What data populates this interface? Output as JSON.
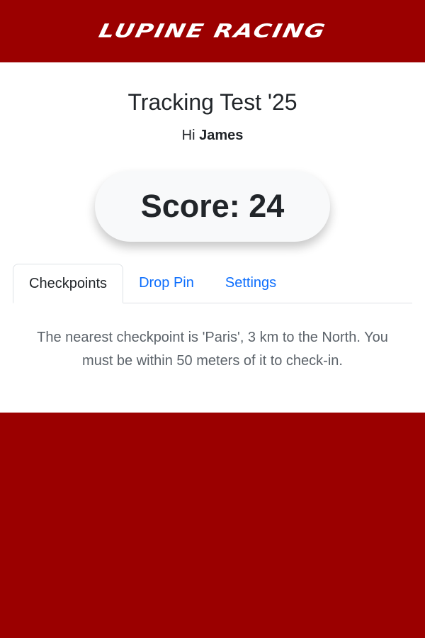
{
  "header": {
    "logo_text": "LUPINE RACING"
  },
  "main": {
    "title": "Tracking Test '25",
    "greeting_prefix": "Hi",
    "user_name": "James",
    "score_text": "Score: 24"
  },
  "tabs": [
    {
      "label": "Checkpoints",
      "active": true
    },
    {
      "label": "Drop Pin",
      "active": false
    },
    {
      "label": "Settings",
      "active": false
    }
  ],
  "content": {
    "message": "The nearest checkpoint is 'Paris', 3 km to the North. You must be within 50 meters of it to check-in."
  },
  "colors": {
    "brand": "#9b0000",
    "link": "#0d6efd",
    "text": "#212529"
  }
}
